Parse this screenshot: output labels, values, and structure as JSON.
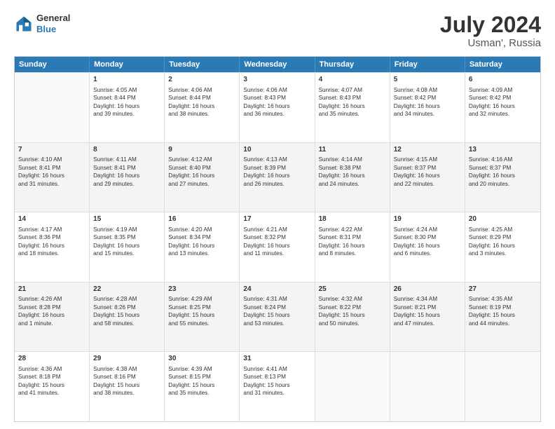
{
  "header": {
    "logo_line1": "General",
    "logo_line2": "Blue",
    "month_year": "July 2024",
    "location": "Usman', Russia"
  },
  "weekdays": [
    "Sunday",
    "Monday",
    "Tuesday",
    "Wednesday",
    "Thursday",
    "Friday",
    "Saturday"
  ],
  "rows": [
    [
      {
        "day": "",
        "info": ""
      },
      {
        "day": "1",
        "info": "Sunrise: 4:05 AM\nSunset: 8:44 PM\nDaylight: 16 hours\nand 39 minutes."
      },
      {
        "day": "2",
        "info": "Sunrise: 4:06 AM\nSunset: 8:44 PM\nDaylight: 16 hours\nand 38 minutes."
      },
      {
        "day": "3",
        "info": "Sunrise: 4:06 AM\nSunset: 8:43 PM\nDaylight: 16 hours\nand 36 minutes."
      },
      {
        "day": "4",
        "info": "Sunrise: 4:07 AM\nSunset: 8:43 PM\nDaylight: 16 hours\nand 35 minutes."
      },
      {
        "day": "5",
        "info": "Sunrise: 4:08 AM\nSunset: 8:42 PM\nDaylight: 16 hours\nand 34 minutes."
      },
      {
        "day": "6",
        "info": "Sunrise: 4:09 AM\nSunset: 8:42 PM\nDaylight: 16 hours\nand 32 minutes."
      }
    ],
    [
      {
        "day": "7",
        "info": "Sunrise: 4:10 AM\nSunset: 8:41 PM\nDaylight: 16 hours\nand 31 minutes."
      },
      {
        "day": "8",
        "info": "Sunrise: 4:11 AM\nSunset: 8:41 PM\nDaylight: 16 hours\nand 29 minutes."
      },
      {
        "day": "9",
        "info": "Sunrise: 4:12 AM\nSunset: 8:40 PM\nDaylight: 16 hours\nand 27 minutes."
      },
      {
        "day": "10",
        "info": "Sunrise: 4:13 AM\nSunset: 8:39 PM\nDaylight: 16 hours\nand 26 minutes."
      },
      {
        "day": "11",
        "info": "Sunrise: 4:14 AM\nSunset: 8:38 PM\nDaylight: 16 hours\nand 24 minutes."
      },
      {
        "day": "12",
        "info": "Sunrise: 4:15 AM\nSunset: 8:37 PM\nDaylight: 16 hours\nand 22 minutes."
      },
      {
        "day": "13",
        "info": "Sunrise: 4:16 AM\nSunset: 8:37 PM\nDaylight: 16 hours\nand 20 minutes."
      }
    ],
    [
      {
        "day": "14",
        "info": "Sunrise: 4:17 AM\nSunset: 8:36 PM\nDaylight: 16 hours\nand 18 minutes."
      },
      {
        "day": "15",
        "info": "Sunrise: 4:19 AM\nSunset: 8:35 PM\nDaylight: 16 hours\nand 15 minutes."
      },
      {
        "day": "16",
        "info": "Sunrise: 4:20 AM\nSunset: 8:34 PM\nDaylight: 16 hours\nand 13 minutes."
      },
      {
        "day": "17",
        "info": "Sunrise: 4:21 AM\nSunset: 8:32 PM\nDaylight: 16 hours\nand 11 minutes."
      },
      {
        "day": "18",
        "info": "Sunrise: 4:22 AM\nSunset: 8:31 PM\nDaylight: 16 hours\nand 8 minutes."
      },
      {
        "day": "19",
        "info": "Sunrise: 4:24 AM\nSunset: 8:30 PM\nDaylight: 16 hours\nand 6 minutes."
      },
      {
        "day": "20",
        "info": "Sunrise: 4:25 AM\nSunset: 8:29 PM\nDaylight: 16 hours\nand 3 minutes."
      }
    ],
    [
      {
        "day": "21",
        "info": "Sunrise: 4:26 AM\nSunset: 8:28 PM\nDaylight: 16 hours\nand 1 minute."
      },
      {
        "day": "22",
        "info": "Sunrise: 4:28 AM\nSunset: 8:26 PM\nDaylight: 15 hours\nand 58 minutes."
      },
      {
        "day": "23",
        "info": "Sunrise: 4:29 AM\nSunset: 8:25 PM\nDaylight: 15 hours\nand 55 minutes."
      },
      {
        "day": "24",
        "info": "Sunrise: 4:31 AM\nSunset: 8:24 PM\nDaylight: 15 hours\nand 53 minutes."
      },
      {
        "day": "25",
        "info": "Sunrise: 4:32 AM\nSunset: 8:22 PM\nDaylight: 15 hours\nand 50 minutes."
      },
      {
        "day": "26",
        "info": "Sunrise: 4:34 AM\nSunset: 8:21 PM\nDaylight: 15 hours\nand 47 minutes."
      },
      {
        "day": "27",
        "info": "Sunrise: 4:35 AM\nSunset: 8:19 PM\nDaylight: 15 hours\nand 44 minutes."
      }
    ],
    [
      {
        "day": "28",
        "info": "Sunrise: 4:36 AM\nSunset: 8:18 PM\nDaylight: 15 hours\nand 41 minutes."
      },
      {
        "day": "29",
        "info": "Sunrise: 4:38 AM\nSunset: 8:16 PM\nDaylight: 15 hours\nand 38 minutes."
      },
      {
        "day": "30",
        "info": "Sunrise: 4:39 AM\nSunset: 8:15 PM\nDaylight: 15 hours\nand 35 minutes."
      },
      {
        "day": "31",
        "info": "Sunrise: 4:41 AM\nSunset: 8:13 PM\nDaylight: 15 hours\nand 31 minutes."
      },
      {
        "day": "",
        "info": ""
      },
      {
        "day": "",
        "info": ""
      },
      {
        "day": "",
        "info": ""
      }
    ]
  ]
}
